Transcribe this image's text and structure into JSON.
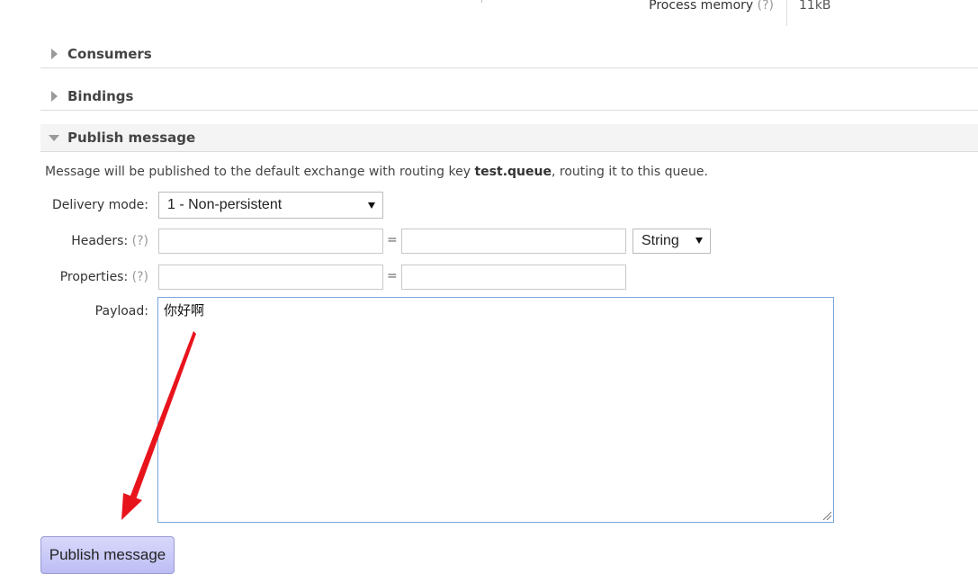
{
  "stats": {
    "process_memory_label": "Process memory",
    "help_marker": "(?)",
    "process_memory_value": "11kB"
  },
  "sections": {
    "consumers": "Consumers",
    "bindings": "Bindings",
    "publish": "Publish message"
  },
  "publish_form": {
    "info_prefix": "Message will be published to the default exchange with routing key ",
    "routing_key": "test.queue",
    "info_suffix": ", routing it to this queue.",
    "delivery_mode_label": "Delivery mode:",
    "delivery_mode_value": "1 - Non-persistent",
    "headers_label": "Headers:",
    "headers_help": "(?)",
    "header_key_value": "",
    "header_value_value": "",
    "equals_sign": "=",
    "header_type_value": "String",
    "properties_label": "Properties:",
    "properties_help": "(?)",
    "property_key_value": "",
    "property_value_value": "",
    "payload_label": "Payload:",
    "payload_value": "你好啊",
    "publish_button_label": "Publish message"
  },
  "colors": {
    "button_bg": "#c8c8f8",
    "annotation_arrow": "#e8141c",
    "payload_border": "#7aa7de"
  }
}
